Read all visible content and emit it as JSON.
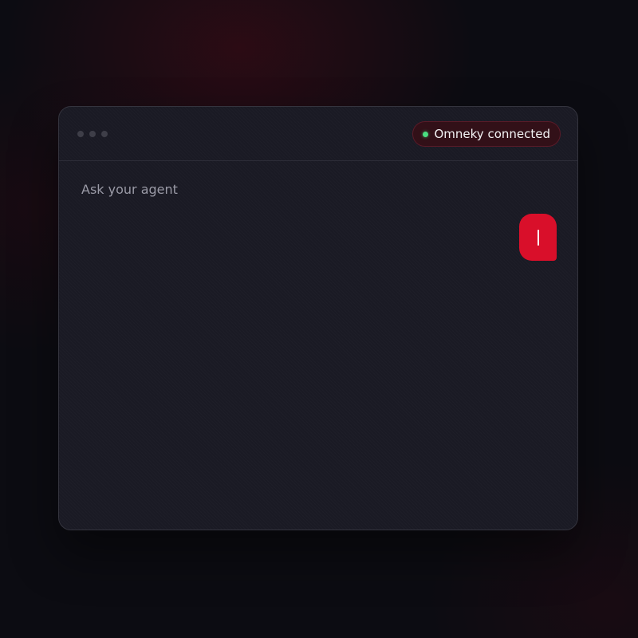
{
  "window": {
    "status_badge": {
      "label": "Omneky connected",
      "indicator_color": "#4ade80"
    }
  },
  "chat": {
    "prompt_label": "Ask your agent",
    "user_message": {
      "text": "",
      "bubble_color": "#d90f2a"
    }
  },
  "colors": {
    "accent": "#d90f2a",
    "background": "#0c0c12",
    "window": "#1a1a24"
  }
}
